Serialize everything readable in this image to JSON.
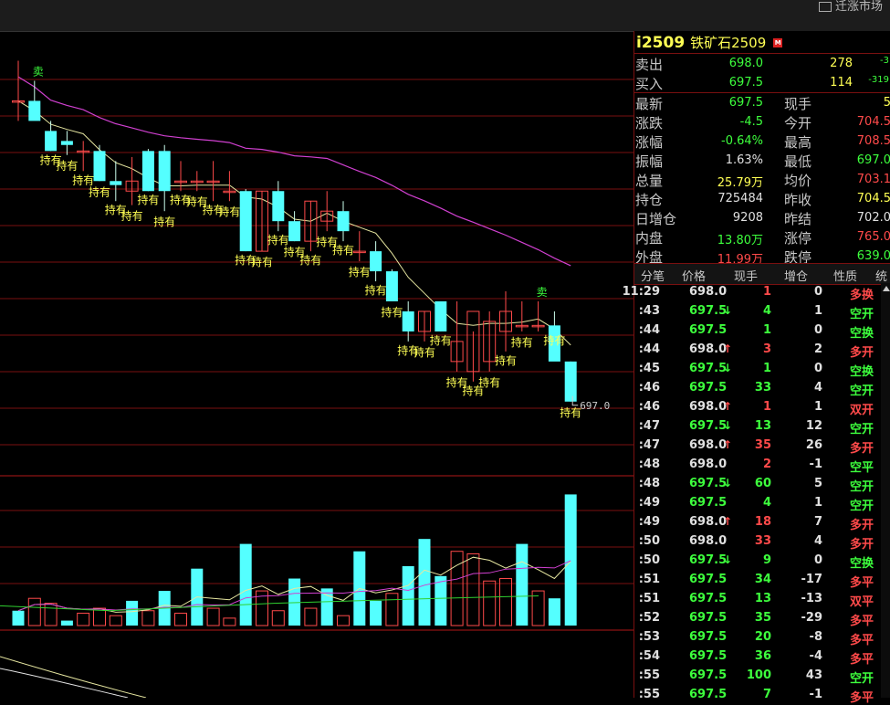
{
  "topbar": {
    "button_label": "迁涨市场"
  },
  "colors": {
    "up": "#ff4a4a",
    "down": "#3dff3d",
    "neutral": "#c8c8c8",
    "price": "#ffff54",
    "cyan": "#54ffff",
    "grid": "#7a1010"
  },
  "icons": {
    "chart_signal": "text-glyph",
    "trade_direction": "arrow-glyph"
  },
  "chart": {
    "sell_label": "卖",
    "hold_label": "持有",
    "last_price_label": "697.0"
  },
  "chart_data": {
    "type": "candlestick",
    "price_readout": 697.0,
    "candles": [
      {
        "o": 712.0,
        "h": 714.0,
        "l": 711.0,
        "c": 712.0
      },
      {
        "o": 712.0,
        "h": 713.0,
        "l": 711.6,
        "c": 711.0
      },
      {
        "o": 710.5,
        "h": 711.0,
        "l": 709.5,
        "c": 709.5
      },
      {
        "o": 710.0,
        "h": 710.5,
        "l": 709.3,
        "c": 709.8
      },
      {
        "o": 709.5,
        "h": 710.0,
        "l": 708.5,
        "c": 709.5
      },
      {
        "o": 709.5,
        "h": 709.8,
        "l": 708.0,
        "c": 708.0
      },
      {
        "o": 708.0,
        "h": 709.0,
        "l": 707.0,
        "c": 707.8
      },
      {
        "o": 707.5,
        "h": 709.2,
        "l": 706.8,
        "c": 708.0
      },
      {
        "o": 709.5,
        "h": 709.6,
        "l": 707.5,
        "c": 707.5
      },
      {
        "o": 709.5,
        "h": 709.8,
        "l": 706.5,
        "c": 707.5
      },
      {
        "o": 708.0,
        "h": 709.0,
        "l": 707.5,
        "c": 708.0
      },
      {
        "o": 708.0,
        "h": 708.5,
        "l": 707.5,
        "c": 708.0
      },
      {
        "o": 708.0,
        "h": 709.0,
        "l": 707.0,
        "c": 708.0
      },
      {
        "o": 707.5,
        "h": 708.5,
        "l": 707.0,
        "c": 707.5
      },
      {
        "o": 707.5,
        "h": 707.6,
        "l": 704.5,
        "c": 704.5
      },
      {
        "o": 704.5,
        "h": 707.5,
        "l": 704.5,
        "c": 707.5
      },
      {
        "o": 707.5,
        "h": 708.0,
        "l": 705.5,
        "c": 706.0
      },
      {
        "o": 706.0,
        "h": 706.5,
        "l": 705.0,
        "c": 705.0
      },
      {
        "o": 705.0,
        "h": 707.0,
        "l": 704.5,
        "c": 707.0
      },
      {
        "o": 706.0,
        "h": 707.5,
        "l": 705.5,
        "c": 706.5
      },
      {
        "o": 706.5,
        "h": 707.0,
        "l": 705.0,
        "c": 705.5
      },
      {
        "o": 704.5,
        "h": 705.5,
        "l": 704.0,
        "c": 704.5
      },
      {
        "o": 704.5,
        "h": 705.0,
        "l": 703.0,
        "c": 703.5
      },
      {
        "o": 703.5,
        "h": 703.6,
        "l": 702.0,
        "c": 702.0
      },
      {
        "o": 701.5,
        "h": 702.0,
        "l": 700.0,
        "c": 700.5
      },
      {
        "o": 700.5,
        "h": 701.5,
        "l": 700.0,
        "c": 701.5
      },
      {
        "o": 702.0,
        "h": 702.0,
        "l": 700.5,
        "c": 700.5
      },
      {
        "o": 699.0,
        "h": 702.0,
        "l": 698.5,
        "c": 700.0
      },
      {
        "o": 698.5,
        "h": 700.5,
        "l": 698.0,
        "c": 701.5
      },
      {
        "o": 699.0,
        "h": 701.5,
        "l": 698.5,
        "c": 701.0
      },
      {
        "o": 700.5,
        "h": 702.5,
        "l": 699.5,
        "c": 701.5
      },
      {
        "o": 700.8,
        "h": 702.0,
        "l": 700.5,
        "c": 700.8
      },
      {
        "o": 700.8,
        "h": 702.0,
        "l": 700.5,
        "c": 700.8
      },
      {
        "o": 700.8,
        "h": 701.5,
        "l": 700.5,
        "c": 699.0
      },
      {
        "o": 699.0,
        "h": 699.0,
        "l": 697.0,
        "c": 697.0
      }
    ],
    "volumes": [
      6,
      11,
      9,
      2,
      5,
      7,
      4,
      10,
      6,
      14,
      5,
      23,
      7,
      3,
      33,
      14,
      6,
      19,
      7,
      15,
      4,
      30,
      10,
      13,
      24,
      35,
      20,
      30,
      29,
      18,
      19,
      33,
      14,
      11,
      53
    ],
    "volume_up": [
      false,
      true,
      true,
      false,
      true,
      true,
      true,
      false,
      true,
      false,
      true,
      false,
      true,
      true,
      false,
      true,
      true,
      false,
      true,
      false,
      true,
      false,
      false,
      true,
      false,
      false,
      false,
      true,
      true,
      true,
      true,
      false,
      true,
      false,
      false
    ],
    "sell_signals": [
      1,
      32
    ],
    "hold_signals": [
      2,
      3,
      4,
      5,
      6,
      7,
      8,
      9,
      10,
      11,
      12,
      13,
      14,
      15,
      16,
      17,
      18,
      19,
      20,
      21,
      22,
      23,
      24,
      25,
      26,
      27,
      28,
      29,
      30,
      31,
      33,
      34
    ]
  },
  "panel": {
    "code": "i2509",
    "name": "铁矿石2509",
    "badge": "M",
    "ask": {
      "label": "卖出",
      "price": "698.0",
      "vol": "278",
      "chg": "-3"
    },
    "bid": {
      "label": "买入",
      "price": "697.5",
      "vol": "114",
      "chg": "-319"
    },
    "stats": [
      {
        "l": "最新",
        "v": "697.5",
        "vc": "g",
        "l2": "现手",
        "v2": "5",
        "v2c": "y"
      },
      {
        "l": "涨跌",
        "v": "-4.5",
        "vc": "g",
        "l2": "今开",
        "v2": "704.5",
        "v2c": "r"
      },
      {
        "l": "涨幅",
        "v": "-0.64%",
        "vc": "g",
        "l2": "最高",
        "v2": "708.5",
        "v2c": "r"
      },
      {
        "l": "振幅",
        "v": "1.63%",
        "vc": "w",
        "l2": "最低",
        "v2": "697.0",
        "v2c": "g"
      },
      {
        "l": "总量",
        "v": "25.79万",
        "vc": "y",
        "l2": "均价",
        "v2": "703.1",
        "v2c": "r"
      },
      {
        "l": "持仓",
        "v": "725484",
        "vc": "w",
        "l2": "昨收",
        "v2": "704.5",
        "v2c": "y"
      },
      {
        "l": "日增仓",
        "v": "9208",
        "vc": "w",
        "l2": "昨结",
        "v2": "702.0",
        "v2c": "w"
      },
      {
        "l": "内盘",
        "v": "13.80万",
        "vc": "g",
        "l2": "涨停",
        "v2": "765.0",
        "v2c": "r"
      },
      {
        "l": "外盘",
        "v": "11.99万",
        "vc": "r",
        "l2": "跌停",
        "v2": "639.0",
        "v2c": "g"
      }
    ],
    "headers": [
      "分笔",
      "价格",
      "现手",
      "增仓",
      "性质",
      "统"
    ],
    "ticks": [
      {
        "t": "11:29",
        "p": "698.0",
        "pc": "w",
        "a": "",
        "v": "1",
        "vc": "r",
        "oi": "0",
        "n": "多换",
        "nc": "r"
      },
      {
        "t": ":43",
        "p": "697.5",
        "pc": "g",
        "a": "↓",
        "v": "4",
        "vc": "g",
        "oi": "1",
        "n": "空开",
        "nc": "g"
      },
      {
        "t": ":44",
        "p": "697.5",
        "pc": "g",
        "a": "",
        "v": "1",
        "vc": "g",
        "oi": "0",
        "n": "空换",
        "nc": "g"
      },
      {
        "t": ":44",
        "p": "698.0",
        "pc": "w",
        "a": "↑",
        "v": "3",
        "vc": "r",
        "oi": "2",
        "n": "多开",
        "nc": "r"
      },
      {
        "t": ":45",
        "p": "697.5",
        "pc": "g",
        "a": "↓",
        "v": "1",
        "vc": "g",
        "oi": "0",
        "n": "空换",
        "nc": "g"
      },
      {
        "t": ":46",
        "p": "697.5",
        "pc": "g",
        "a": "",
        "v": "33",
        "vc": "g",
        "oi": "4",
        "n": "空开",
        "nc": "g"
      },
      {
        "t": ":46",
        "p": "698.0",
        "pc": "w",
        "a": "↑",
        "v": "1",
        "vc": "r",
        "oi": "1",
        "n": "双开",
        "nc": "r"
      },
      {
        "t": ":47",
        "p": "697.5",
        "pc": "g",
        "a": "↓",
        "v": "13",
        "vc": "g",
        "oi": "12",
        "n": "空开",
        "nc": "g"
      },
      {
        "t": ":47",
        "p": "698.0",
        "pc": "w",
        "a": "↑",
        "v": "35",
        "vc": "r",
        "oi": "26",
        "n": "多开",
        "nc": "r"
      },
      {
        "t": ":48",
        "p": "698.0",
        "pc": "w",
        "a": "",
        "v": "2",
        "vc": "r",
        "oi": "-1",
        "n": "空平",
        "nc": "g"
      },
      {
        "t": ":48",
        "p": "697.5",
        "pc": "g",
        "a": "↓",
        "v": "60",
        "vc": "g",
        "oi": "5",
        "n": "空开",
        "nc": "g"
      },
      {
        "t": ":49",
        "p": "697.5",
        "pc": "g",
        "a": "",
        "v": "4",
        "vc": "g",
        "oi": "1",
        "n": "空开",
        "nc": "g"
      },
      {
        "t": ":49",
        "p": "698.0",
        "pc": "w",
        "a": "↑",
        "v": "18",
        "vc": "r",
        "oi": "7",
        "n": "多开",
        "nc": "r"
      },
      {
        "t": ":50",
        "p": "698.0",
        "pc": "w",
        "a": "",
        "v": "33",
        "vc": "r",
        "oi": "4",
        "n": "多开",
        "nc": "r"
      },
      {
        "t": ":50",
        "p": "697.5",
        "pc": "g",
        "a": "↓",
        "v": "9",
        "vc": "g",
        "oi": "0",
        "n": "空换",
        "nc": "g"
      },
      {
        "t": ":51",
        "p": "697.5",
        "pc": "g",
        "a": "",
        "v": "34",
        "vc": "g",
        "oi": "-17",
        "n": "多平",
        "nc": "r"
      },
      {
        "t": ":51",
        "p": "697.5",
        "pc": "g",
        "a": "",
        "v": "13",
        "vc": "g",
        "oi": "-13",
        "n": "双平",
        "nc": "r"
      },
      {
        "t": ":52",
        "p": "697.5",
        "pc": "g",
        "a": "",
        "v": "35",
        "vc": "g",
        "oi": "-29",
        "n": "多平",
        "nc": "r"
      },
      {
        "t": ":53",
        "p": "697.5",
        "pc": "g",
        "a": "",
        "v": "20",
        "vc": "g",
        "oi": "-8",
        "n": "多平",
        "nc": "r"
      },
      {
        "t": ":54",
        "p": "697.5",
        "pc": "g",
        "a": "",
        "v": "36",
        "vc": "g",
        "oi": "-4",
        "n": "多平",
        "nc": "r"
      },
      {
        "t": ":55",
        "p": "697.5",
        "pc": "g",
        "a": "",
        "v": "100",
        "vc": "g",
        "oi": "43",
        "n": "空开",
        "nc": "g"
      },
      {
        "t": ":55",
        "p": "697.5",
        "pc": "g",
        "a": "",
        "v": "7",
        "vc": "g",
        "oi": "-1",
        "n": "多平",
        "nc": "r"
      }
    ]
  }
}
